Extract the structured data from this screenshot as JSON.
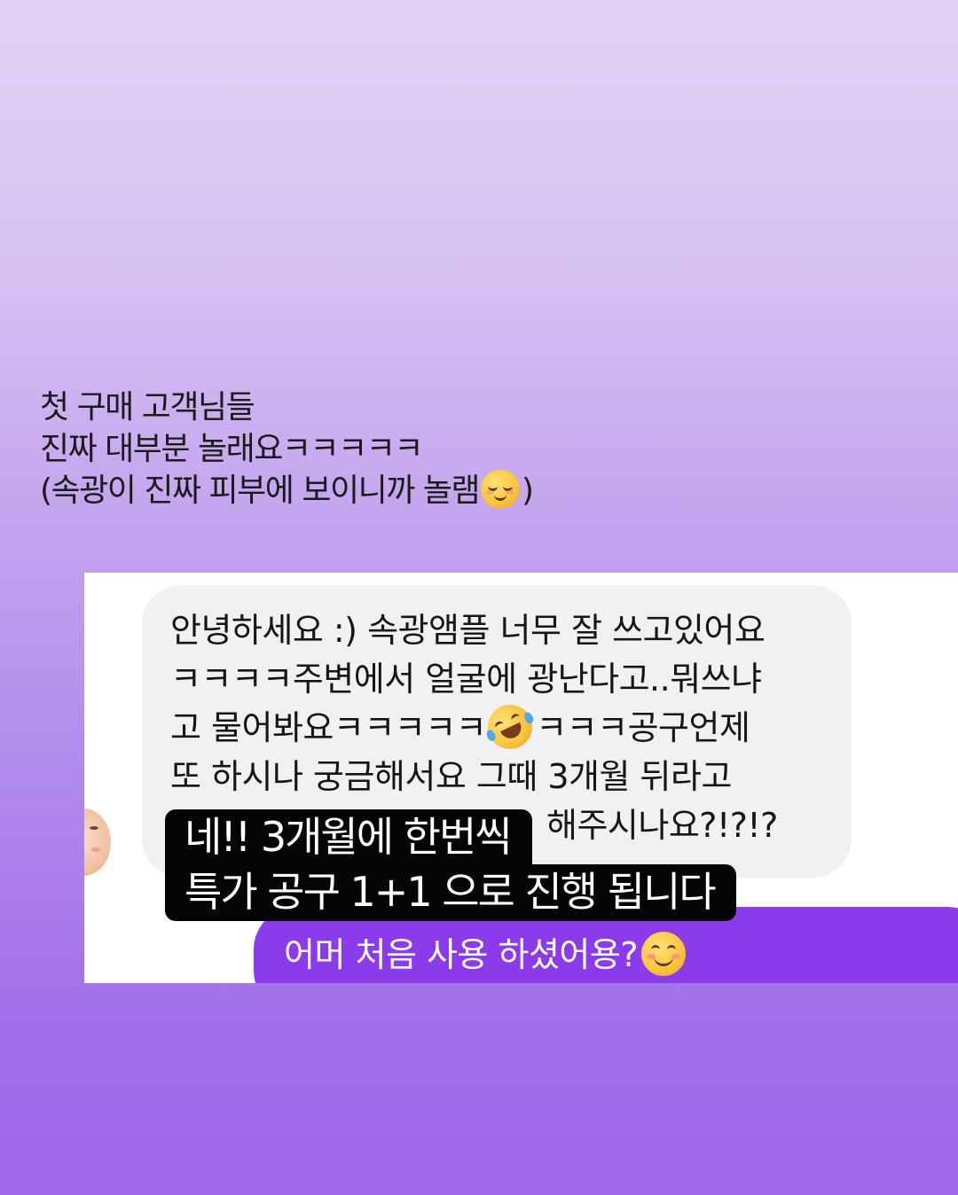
{
  "caption": {
    "line1": "첫 구매 고객님들",
    "line2": "진짜 대부분 놀래요ㅋㅋㅋㅋㅋ",
    "line3_text": "(속광이 진짜 피부에 보이니까 놀램",
    "line3_emoji": "relieved-face",
    "line3_end": ")"
  },
  "chat": {
    "incoming_message": {
      "line1": "안녕하세요 :) 속광앰플 너무 잘 쓰고있어요",
      "line2": "ㅋㅋㅋㅋ주변에서 얼굴에 광난다고..뭐쓰냐",
      "line3_before_emoji": "고 물어봐요ㅋㅋㅋㅋㅋ",
      "line3_emoji": "rolling-on-floor-laughing",
      "line3_after_emoji": "ㅋㅋㅋ공구언제",
      "line4": "또 하시나 궁금해서요 그때 3개월 뒤라고",
      "line5_visible": "해주시나요?!?!?"
    },
    "outgoing_message": {
      "text": "어머 처음 사용 하셨어용?",
      "emoji": "smiling-face-with-smiling-eyes"
    }
  },
  "overlay": {
    "line1": "네!! 3개월에 한번씩",
    "line2": "특가 공구 1+1 으로 진행 됩니다"
  },
  "colors": {
    "background_top": "#e2d2f4",
    "background_bottom": "#9e66e8",
    "incoming_bubble": "#f1f1f3",
    "outgoing_bubble": "#8b3bea",
    "overlay_label": "#050505"
  }
}
